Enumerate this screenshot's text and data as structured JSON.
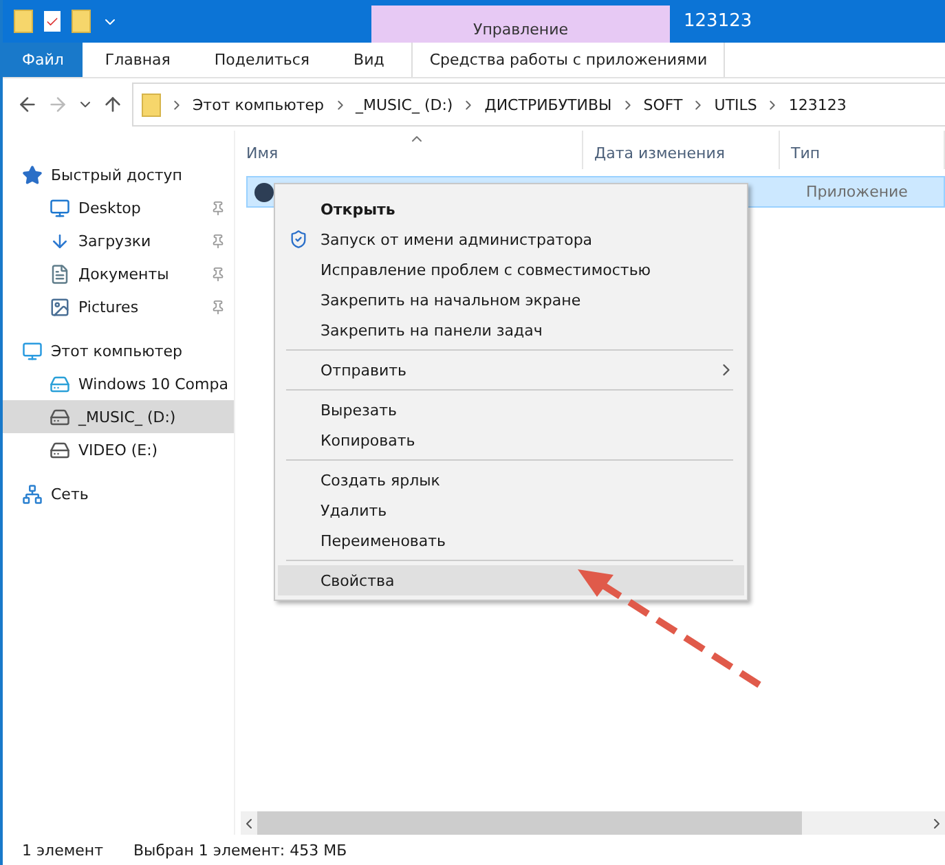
{
  "title_bar": {
    "contextual_tab": "Управление",
    "title": "123123"
  },
  "ribbon_tabs": [
    {
      "label": "Файл",
      "selected": true,
      "kind": "file"
    },
    {
      "label": "Главная",
      "selected": false,
      "kind": "plain"
    },
    {
      "label": "Поделиться",
      "selected": false,
      "kind": "plain"
    },
    {
      "label": "Вид",
      "selected": false,
      "kind": "plain"
    },
    {
      "label": "Средства работы с приложениями",
      "selected": false,
      "kind": "contextual"
    }
  ],
  "address_bar": {
    "path": [
      "Этот компьютер",
      "_MUSIC_ (D:)",
      "ДИСТРИБУТИВЫ",
      "SOFT",
      "UTILS",
      "123123"
    ]
  },
  "sidebar": {
    "items": [
      {
        "label": "Быстрый доступ",
        "kind": "star",
        "selected": false,
        "children": [
          {
            "label": "Desktop",
            "kind": "desktop",
            "selected": false,
            "pinned": true
          },
          {
            "label": "Загрузки",
            "kind": "download",
            "selected": false,
            "pinned": true
          },
          {
            "label": "Документы",
            "kind": "documents",
            "selected": false,
            "pinned": true
          },
          {
            "label": "Pictures",
            "kind": "pictures",
            "selected": false,
            "pinned": true
          }
        ]
      },
      {
        "label": "Этот компьютер",
        "kind": "computer",
        "selected": false,
        "children": [
          {
            "label": "Windows 10 Compa",
            "kind": "system-drive",
            "selected": false
          },
          {
            "label": "_MUSIC_ (D:)",
            "kind": "drive",
            "selected": true
          },
          {
            "label": "VIDEO (E:)",
            "kind": "drive",
            "selected": false
          }
        ]
      },
      {
        "label": "Сеть",
        "kind": "network",
        "selected": false
      }
    ]
  },
  "table": {
    "columns": [
      {
        "label": "Имя",
        "sorted": true
      },
      {
        "label": "Дата изменения",
        "sorted": false
      },
      {
        "label": "Тип",
        "sorted": false
      }
    ],
    "rows": [
      {
        "type": "Приложение",
        "selected": true
      }
    ]
  },
  "context_menu": {
    "items": [
      {
        "kind": "item",
        "label": "Открыть",
        "default": true,
        "shield": false,
        "submenu": false,
        "selected": false
      },
      {
        "kind": "item",
        "label": "Запуск от имени администратора",
        "default": false,
        "shield": true,
        "submenu": false,
        "selected": false
      },
      {
        "kind": "item",
        "label": "Исправление проблем с совместимостью",
        "default": false,
        "shield": false,
        "submenu": false,
        "selected": false
      },
      {
        "kind": "item",
        "label": "Закрепить на начальном экране",
        "default": false,
        "shield": false,
        "submenu": false,
        "selected": false
      },
      {
        "kind": "item",
        "label": "Закрепить на панели задач",
        "default": false,
        "shield": false,
        "submenu": false,
        "selected": false
      },
      {
        "kind": "separator"
      },
      {
        "kind": "item",
        "label": "Отправить",
        "default": false,
        "shield": false,
        "submenu": true,
        "selected": false
      },
      {
        "kind": "separator"
      },
      {
        "kind": "item",
        "label": "Вырезать",
        "default": false,
        "shield": false,
        "submenu": false,
        "selected": false
      },
      {
        "kind": "item",
        "label": "Копировать",
        "default": false,
        "shield": false,
        "submenu": false,
        "selected": false
      },
      {
        "kind": "separator"
      },
      {
        "kind": "item",
        "label": "Создать ярлык",
        "default": false,
        "shield": false,
        "submenu": false,
        "selected": false
      },
      {
        "kind": "item",
        "label": "Удалить",
        "default": false,
        "shield": false,
        "submenu": false,
        "selected": false
      },
      {
        "kind": "item",
        "label": "Переименовать",
        "default": false,
        "shield": false,
        "submenu": false,
        "selected": false
      },
      {
        "kind": "separator"
      },
      {
        "kind": "item",
        "label": "Свойства",
        "default": false,
        "shield": false,
        "submenu": false,
        "selected": true
      }
    ]
  },
  "status_bar": {
    "count": "1 элемент",
    "selection": "Выбран 1 элемент: 453 МБ"
  }
}
